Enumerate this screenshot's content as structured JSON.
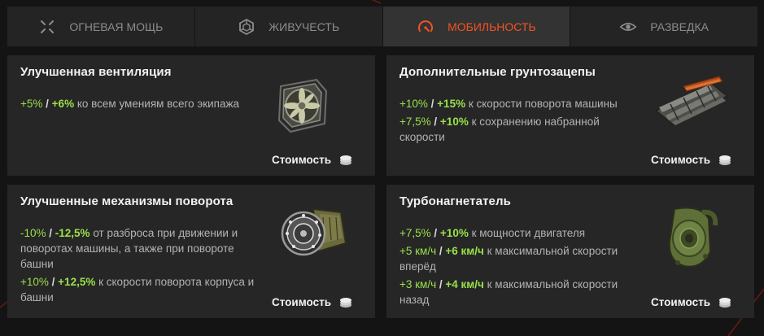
{
  "tabs": [
    {
      "label": "Огневая мощь",
      "icon": "crosshair-icon",
      "active": false
    },
    {
      "label": "Живучесть",
      "icon": "hexagon-armor-icon",
      "active": false
    },
    {
      "label": "Мобильность",
      "icon": "speedometer-icon",
      "active": true
    },
    {
      "label": "Разведка",
      "icon": "eye-icon",
      "active": false
    }
  ],
  "colors": {
    "active_tab": "#f25322",
    "bonus_green": "#9be04a",
    "card_bg": "#262626",
    "page_bg": "#141414"
  },
  "cost_label": "Стоимость",
  "cards": [
    {
      "title": "Улучшенная вентиляция",
      "image": "ventilation-fan-icon",
      "bonuses": [
        {
          "v1": "+5%",
          "sep": " / ",
          "v2": "+6%",
          "text": " ко всем умениям всего экипажа"
        }
      ]
    },
    {
      "title": "Дополнительные грунтозацепы",
      "image": "track-grousers-icon",
      "bonuses": [
        {
          "v1": "+10%",
          "sep": " / ",
          "v2": "+15%",
          "text": " к скорости поворота машины"
        },
        {
          "v1": "+7,5%",
          "sep": " / ",
          "v2": "+10%",
          "text": " к сохранению набранной скорости"
        }
      ]
    },
    {
      "title": "Улучшенные механизмы поворота",
      "image": "turning-mechanism-icon",
      "bonuses": [
        {
          "v1": "-10%",
          "sep": " / ",
          "v2": "-12,5%",
          "text": " от разброса при движении и поворотах машины, а также при повороте башни"
        },
        {
          "v1": "+10%",
          "sep": " / ",
          "v2": "+12,5%",
          "text": " к скорости поворота корпуса и башни"
        }
      ]
    },
    {
      "title": "Турбонагнетатель",
      "image": "turbocharger-icon",
      "bonuses": [
        {
          "v1": "+7,5%",
          "sep": " / ",
          "v2": "+10%",
          "text": " к мощности двигателя"
        },
        {
          "v1": "+5 км/ч",
          "sep": " / ",
          "v2": "+6 км/ч",
          "text": " к максимальной скорости вперёд"
        },
        {
          "v1": "+3 км/ч",
          "sep": " / ",
          "v2": "+4 км/ч",
          "text": " к максимальной скорости назад"
        }
      ]
    }
  ]
}
